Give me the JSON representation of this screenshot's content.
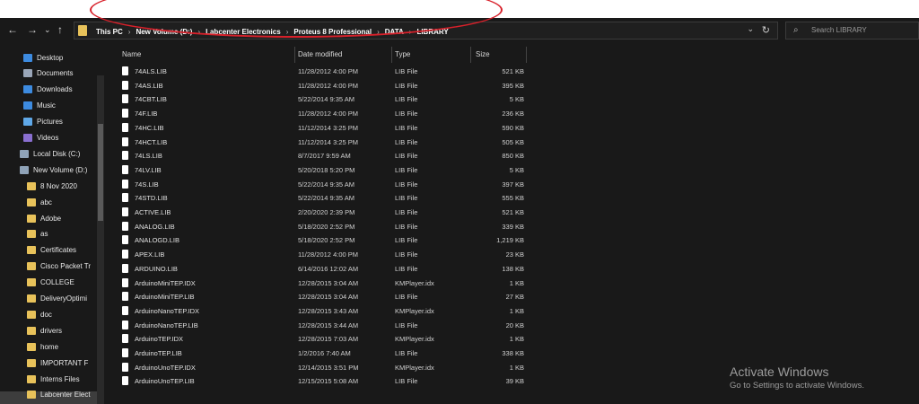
{
  "address_bar": {
    "back": "←",
    "forward": "→",
    "recent": "⌄",
    "up": "↑",
    "crumbs": [
      "This PC",
      "New Volume (D:)",
      "Labcenter Electronics",
      "Proteus 8 Professional",
      "DATA",
      "LIBRARY"
    ],
    "separator": "›",
    "dropdown": "⌄",
    "refresh": "↻"
  },
  "search": {
    "icon": "⌕",
    "placeholder": "Search LIBRARY"
  },
  "nav": {
    "items": [
      {
        "label": "Desktop",
        "icon": "desktop-icon",
        "color": "#3d8be0"
      },
      {
        "label": "Documents",
        "icon": "documents-icon",
        "color": "#9aa6b8"
      },
      {
        "label": "Downloads",
        "icon": "downloads-icon",
        "color": "#3d8be0"
      },
      {
        "label": "Music",
        "icon": "music-icon",
        "color": "#3d8be0"
      },
      {
        "label": "Pictures",
        "icon": "pictures-icon",
        "color": "#5fa8e8"
      },
      {
        "label": "Videos",
        "icon": "videos-icon",
        "color": "#8a6fd0"
      },
      {
        "label": "Local Disk (C:)",
        "icon": "drive-icon",
        "color": "#8fa3b8"
      },
      {
        "label": "New Volume (D:)",
        "icon": "drive-icon",
        "color": "#8fa3b8"
      },
      {
        "label": "8 Nov 2020",
        "icon": "folder-icon",
        "color": "#e8c25a"
      },
      {
        "label": "abc",
        "icon": "folder-icon",
        "color": "#e8c25a"
      },
      {
        "label": "Adobe",
        "icon": "folder-icon",
        "color": "#e8c25a"
      },
      {
        "label": "as",
        "icon": "folder-icon",
        "color": "#e8c25a"
      },
      {
        "label": "Certificates",
        "icon": "folder-icon",
        "color": "#e8c25a"
      },
      {
        "label": "Cisco Packet Tr",
        "icon": "folder-icon",
        "color": "#e8c25a"
      },
      {
        "label": "COLLEGE",
        "icon": "folder-icon",
        "color": "#e8c25a"
      },
      {
        "label": "DeliveryOptimi",
        "icon": "folder-icon",
        "color": "#e8c25a"
      },
      {
        "label": "doc",
        "icon": "folder-icon",
        "color": "#e8c25a"
      },
      {
        "label": "drivers",
        "icon": "folder-icon",
        "color": "#e8c25a"
      },
      {
        "label": "home",
        "icon": "folder-icon",
        "color": "#e8c25a"
      },
      {
        "label": "IMPORTANT F",
        "icon": "folder-icon",
        "color": "#e8c25a"
      },
      {
        "label": "Interns Files",
        "icon": "folder-icon",
        "color": "#e8c25a"
      },
      {
        "label": "Labcenter Elect",
        "icon": "folder-icon",
        "color": "#e8c25a"
      }
    ]
  },
  "columns": {
    "name": "Name",
    "date": "Date modified",
    "type": "Type",
    "size": "Size"
  },
  "files": [
    {
      "name": "74ALS.LIB",
      "date": "11/28/2012 4:00 PM",
      "type": "LIB File",
      "size": "521 KB"
    },
    {
      "name": "74AS.LIB",
      "date": "11/28/2012 4:00 PM",
      "type": "LIB File",
      "size": "395 KB"
    },
    {
      "name": "74CBT.LIB",
      "date": "5/22/2014 9:35 AM",
      "type": "LIB File",
      "size": "5 KB"
    },
    {
      "name": "74F.LIB",
      "date": "11/28/2012 4:00 PM",
      "type": "LIB File",
      "size": "236 KB"
    },
    {
      "name": "74HC.LIB",
      "date": "11/12/2014 3:25 PM",
      "type": "LIB File",
      "size": "590 KB"
    },
    {
      "name": "74HCT.LIB",
      "date": "11/12/2014 3:25 PM",
      "type": "LIB File",
      "size": "505 KB"
    },
    {
      "name": "74LS.LIB",
      "date": "8/7/2017 9:59 AM",
      "type": "LIB File",
      "size": "850 KB"
    },
    {
      "name": "74LV.LIB",
      "date": "5/20/2018 5:20 PM",
      "type": "LIB File",
      "size": "5 KB"
    },
    {
      "name": "74S.LIB",
      "date": "5/22/2014 9:35 AM",
      "type": "LIB File",
      "size": "397 KB"
    },
    {
      "name": "74STD.LIB",
      "date": "5/22/2014 9:35 AM",
      "type": "LIB File",
      "size": "555 KB"
    },
    {
      "name": "ACTIVE.LIB",
      "date": "2/20/2020 2:39 PM",
      "type": "LIB File",
      "size": "521 KB"
    },
    {
      "name": "ANALOG.LIB",
      "date": "5/18/2020 2:52 PM",
      "type": "LIB File",
      "size": "339 KB"
    },
    {
      "name": "ANALOGD.LIB",
      "date": "5/18/2020 2:52 PM",
      "type": "LIB File",
      "size": "1,219 KB"
    },
    {
      "name": "APEX.LIB",
      "date": "11/28/2012 4:00 PM",
      "type": "LIB File",
      "size": "23 KB"
    },
    {
      "name": "ARDUINO.LIB",
      "date": "6/14/2016 12:02 AM",
      "type": "LIB File",
      "size": "138 KB"
    },
    {
      "name": "ArduinoMiniTEP.IDX",
      "date": "12/28/2015 3:04 AM",
      "type": "KMPlayer.idx",
      "size": "1 KB"
    },
    {
      "name": "ArduinoMiniTEP.LIB",
      "date": "12/28/2015 3:04 AM",
      "type": "LIB File",
      "size": "27 KB"
    },
    {
      "name": "ArduinoNanoTEP.IDX",
      "date": "12/28/2015 3:43 AM",
      "type": "KMPlayer.idx",
      "size": "1 KB"
    },
    {
      "name": "ArduinoNanoTEP.LIB",
      "date": "12/28/2015 3:44 AM",
      "type": "LIB File",
      "size": "20 KB"
    },
    {
      "name": "ArduinoTEP.IDX",
      "date": "12/28/2015 7:03 AM",
      "type": "KMPlayer.idx",
      "size": "1 KB"
    },
    {
      "name": "ArduinoTEP.LIB",
      "date": "1/2/2016 7:40 AM",
      "type": "LIB File",
      "size": "338 KB"
    },
    {
      "name": "ArduinoUnoTEP.IDX",
      "date": "12/14/2015 3:51 PM",
      "type": "KMPlayer.idx",
      "size": "1 KB"
    },
    {
      "name": "ArduinoUnoTEP.LIB",
      "date": "12/15/2015 5:08 AM",
      "type": "LIB File",
      "size": "39 KB"
    }
  ],
  "watermark": {
    "title": "Activate Windows",
    "subtitle": "Go to Settings to activate Windows."
  },
  "colors": {
    "annotation": "#d8202a",
    "background": "#191919"
  }
}
